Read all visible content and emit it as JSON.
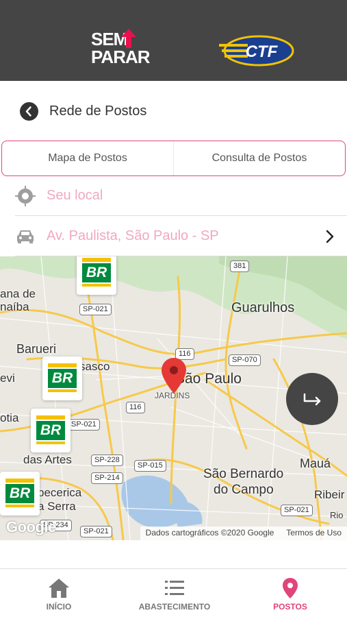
{
  "header": {
    "brand_left_line1": "SEM",
    "brand_left_line2": "PARAR",
    "brand_right": "CTF"
  },
  "page": {
    "title": "Rede de Postos"
  },
  "tabs": [
    {
      "label": "Mapa de Postos"
    },
    {
      "label": "Consulta de Postos"
    }
  ],
  "location": {
    "current_label": "Seu local",
    "destination_label": "Av. Paulista, São Paulo - SP"
  },
  "map": {
    "places": [
      "Guarulhos",
      "Barueri",
      "São Paulo",
      "JARDINS",
      "São Bernardo",
      "do Campo",
      "Mauá",
      "Ribeir",
      "Rio",
      "das Artes",
      "sasco",
      "ana de",
      "naíba",
      "evi",
      "otia",
      "becerica",
      "a Serra"
    ],
    "shields": [
      "381",
      "SP-021",
      "116",
      "SP-070",
      "SP-021",
      "116",
      "SP-228",
      "SP-214",
      "SP-015",
      "SP-021",
      "SP-234",
      "SP-021"
    ],
    "station_brand": "BR",
    "google_logo": "Google",
    "attribution": "Dados cartográficos ©2020 Google",
    "terms": "Termos de Uso"
  },
  "bottom_nav": [
    {
      "label": "INÍCIO",
      "icon": "home-icon"
    },
    {
      "label": "ABASTECIMENTO",
      "icon": "list-icon"
    },
    {
      "label": "POSTOS",
      "icon": "map-pin-icon"
    }
  ],
  "colors": {
    "accent": "#e0457b",
    "topbar": "#454545",
    "placeholder": "#f0a8c3",
    "br_green": "#008a3e",
    "br_yellow": "#f2c200"
  }
}
